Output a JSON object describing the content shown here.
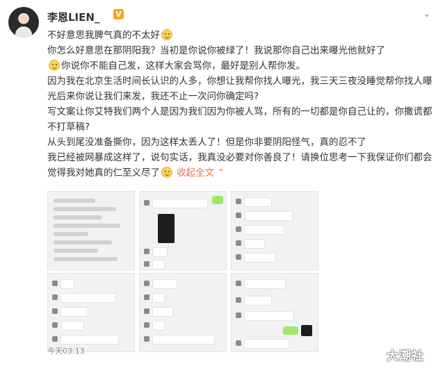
{
  "user": {
    "name": "李恩LIEN_",
    "verified_badge": "V"
  },
  "post": {
    "lines": [
      "不好意思我脾气真的不太好",
      "你怎么好意思在那阴阳我？当初是你说你被绿了！我说那你自己出来曝光他就好了",
      "你说你不能自己发，这样大家会骂你，最好是别人帮你发。",
      "因为我在北京生活时间长认识的人多，你想让我帮你找人曝光，我三天三夜没睡觉帮你找人曝光后来你说让我们来发，我还不止一次问你确定吗?",
      "写文案让你艾特我们两个人是因为我们因为你被人骂，所有的一切都是你自己让的，你撒谎都不打草稿?",
      "从头到尾没准备撕你，因为这样太丢人了！但是你非要阴阳怪气，真的忍不了",
      "我已经被网暴成这样了，说句实话，我真没必要对你善良了！请换位思考一下我保证你们都会觉得我对她真的仁至义尽了"
    ],
    "collapse_label": "收起全文",
    "timestamp": "今天03:13"
  },
  "watermark": "大潮社",
  "icons": {
    "avatar": "avatar-photo",
    "dropdown": "chevron-down-icon",
    "emoji": "smile-emoji-icon"
  },
  "colors": {
    "link": "#eb7350",
    "badge": "#f4a623"
  }
}
